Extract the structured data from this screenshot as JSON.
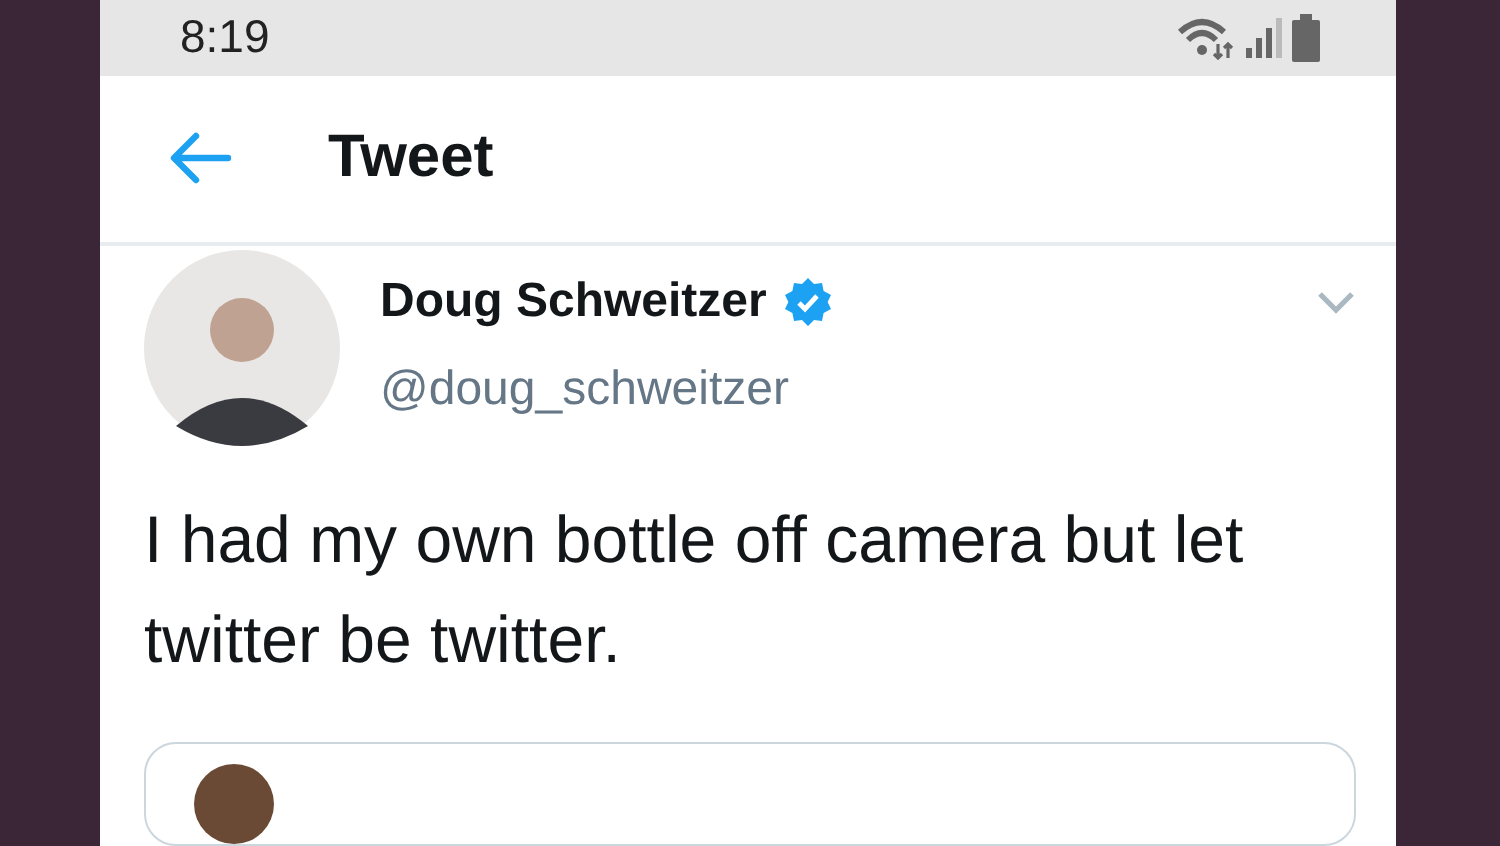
{
  "status_bar": {
    "time": "8:19"
  },
  "header": {
    "title": "Tweet"
  },
  "tweet": {
    "name": "Doug Schweitzer",
    "verified": true,
    "handle": "@doug_schweitzer",
    "text": "I had my own bottle off camera but let twitter be twitter."
  }
}
